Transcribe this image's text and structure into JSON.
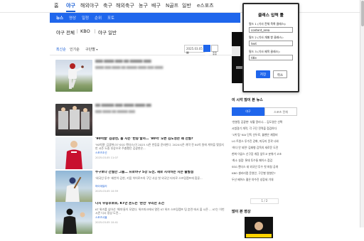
{
  "top_nav": {
    "items": [
      "홈",
      "야구",
      "해외야구",
      "축구",
      "해외축구",
      "농구",
      "배구",
      "N골프",
      "일반",
      "e스포츠"
    ],
    "active_index": 1
  },
  "sub_nav": {
    "items": [
      "뉴스",
      "영상",
      "일정",
      "순위",
      "포토"
    ],
    "active_index": 0
  },
  "baseball_bar": {
    "items": [
      "야구 전체",
      "KBO",
      "야구 일반"
    ]
  },
  "filter": {
    "tabs": [
      "최신순",
      "인기순",
      "구단별"
    ],
    "date_label": "2025.03.05"
  },
  "articles": [
    {
      "title": "",
      "desc": "",
      "source": "",
      "time": "",
      "blurred": true
    },
    {
      "title": "",
      "desc": "",
      "source": "",
      "time": "",
      "blurred": true
    },
    {
      "title": "'90억팔' 김광현, 올 시즌 '반등'할까… '80억' 오른 김도영은 왜 선발?",
      "desc": "'90억팔' 김광현(37·SSG 랜더스)이 2025 시즌 반등을 준비한다. 2024시즌 개막 전 80억 원에 계약을 맺었지만 시즌 도중 부상으로 주춤했던 김광현은...",
      "source": "스포츠조선",
      "time": "2025.03.05 11:07"
    },
    {
      "title": "누구보다 간절한 그들… 프로야구 5강 도전, 새로 시작하는 시즌 출발점",
      "desc": "'외국인 투수' 배찬이·김현, 키움 히어로즈의 구단 사상 첫 외국인 타자로 스프링캠프에 합류...",
      "source": "마이데일리",
      "time": "2025.03.05 10:59"
    },
    {
      "title": "다시 우승후보로, KT만 흔드는 '완전' 우리한 조건",
      "desc": "KT 위즈를 넘어선 '해피'들이 모였다. 위즈파크에서 열린 KT 위즈 스프링캠프 팀 훈련 에서 올 시즌 ... KT는 이번 시즌 다시 정상 도전...",
      "source": "스포츠서울",
      "time": "2025.03.05 10:41"
    }
  ],
  "right_col": {
    "popular_header": "이 시각 많이 본 뉴스",
    "popular_tabs": [
      "야구",
      "스포츠 전체"
    ],
    "popular_list": [
      "'연봉킹 김광현' 부활 알리나… 김도영은 선택",
      "시범경기 개막, 각 구단 전력을 점검하다",
      "'1위 팀' KIA 단독 선두로, 불펜은 재정비",
      "LG 트윈스 투수진 강화, 마무리 윤곽 나와",
      "'하다 안 되면' 김태형 감독의 새로운 도전",
      "한화 이글스 신구장 개장 앞두고 분위기 고조",
      "'최소 실점' 롯데 투수들 페이스 점검",
      "SSG 랜더스 새 외국인 투수 첫 피칭 공개",
      "KBO 샐러리캡 운영안, 구단별 영향은?",
      "두산 베어스 젊은 야수진 성장세 기대"
    ],
    "pager": "1 / 2",
    "video_header": "많이 본 영상"
  },
  "popup": {
    "title": "클래스 입력 툴",
    "label1": "필드 1 (기사 전체 목록 클래스):",
    "value1": "content_area",
    "label2": "필드 2 (기사 개별 항 클래스):",
    "value2": "text",
    "label3": "필드 3 (기사 제목 클래스):",
    "value3": "title",
    "save_label": "저장",
    "cancel_label": "취소"
  },
  "colors": {
    "brand_blue": "#1f66ec"
  }
}
